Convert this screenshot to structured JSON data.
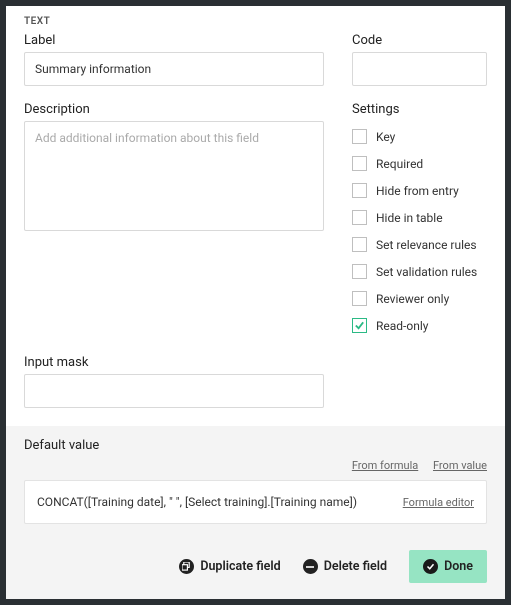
{
  "type_label": "TEXT",
  "label": {
    "title": "Label",
    "value": "Summary information"
  },
  "code": {
    "title": "Code",
    "value": ""
  },
  "description": {
    "title": "Description",
    "placeholder": "Add additional information about this field",
    "value": ""
  },
  "settings": {
    "title": "Settings",
    "items": [
      {
        "label": "Key",
        "checked": false
      },
      {
        "label": "Required",
        "checked": false
      },
      {
        "label": "Hide from entry",
        "checked": false
      },
      {
        "label": "Hide in table",
        "checked": false
      },
      {
        "label": "Set relevance rules",
        "checked": false
      },
      {
        "label": "Set validation rules",
        "checked": false
      },
      {
        "label": "Reviewer only",
        "checked": false
      },
      {
        "label": "Read-only",
        "checked": true
      }
    ]
  },
  "input_mask": {
    "title": "Input mask",
    "value": ""
  },
  "default_value": {
    "title": "Default value",
    "links": {
      "from_formula": "From formula",
      "from_value": "From value"
    },
    "formula": "CONCAT([Training date], \" \", [Select training].[Training name])",
    "editor_link": "Formula editor"
  },
  "footer": {
    "duplicate": "Duplicate field",
    "delete": "Delete field",
    "done": "Done"
  }
}
